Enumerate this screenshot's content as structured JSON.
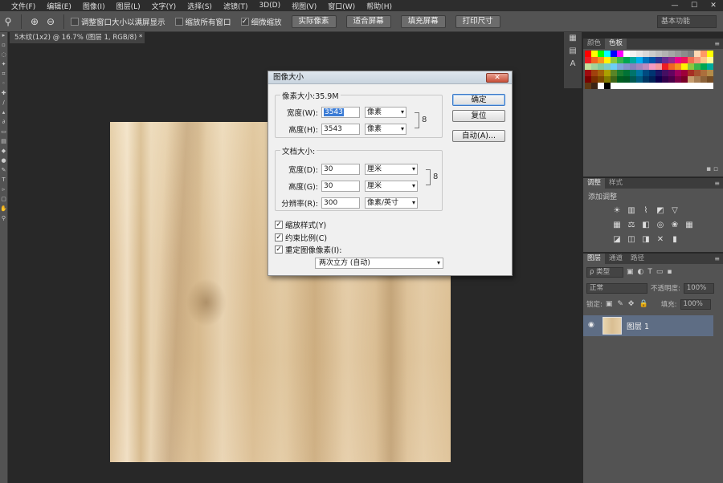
{
  "menubar": {
    "items": [
      "文件(F)",
      "编辑(E)",
      "图像(I)",
      "图层(L)",
      "文字(Y)",
      "选择(S)",
      "滤镜(T)",
      "3D(D)",
      "视图(V)",
      "窗口(W)",
      "帮助(H)"
    ],
    "window_controls": [
      "—",
      "☐",
      "✕"
    ]
  },
  "optbar": {
    "zoom_in_glyph": "⊕",
    "zoom_out_glyph": "⊖",
    "resize_windows_label": "调整窗口大小以满屏显示",
    "zoom_all_label": "缩放所有窗口",
    "scrubby_zoom_label": "细微缩放",
    "actual_pixels": "实际像素",
    "fit_screen": "适合屏幕",
    "fill_screen": "填充屏幕",
    "print_size": "打印尺寸",
    "workspace": "基本功能"
  },
  "doc_tab": {
    "title": "5木纹(1x2) @ 16.7% (图层 1, RGB/8) * ×"
  },
  "dialog": {
    "title": "图像大小",
    "close_glyph": "✕",
    "pixel_dimensions": "像素大小:35.9M",
    "width_label": "宽度(W):",
    "width_value": "3543",
    "width_unit": "像素",
    "height_label": "高度(H):",
    "height_value": "3543",
    "height_unit": "像素",
    "doc_size_legend": "文档大小:",
    "doc_width_label": "宽度(D):",
    "doc_width_value": "30",
    "doc_width_unit": "厘米",
    "doc_height_label": "高度(G):",
    "doc_height_value": "30",
    "doc_height_unit": "厘米",
    "resolution_label": "分辨率(R):",
    "resolution_value": "300",
    "resolution_unit": "像素/英寸",
    "scale_styles": "缩放样式(Y)",
    "constrain": "约束比例(C)",
    "resample": "重定图像像素(I):",
    "resample_method": "两次立方 (自动)",
    "ok": "确定",
    "reset": "复位",
    "auto": "自动(A)...",
    "check_glyph": "✓",
    "link_glyph": "8"
  },
  "panels": {
    "color_tabs": [
      "颜色",
      "色板"
    ],
    "adjust_tabs": [
      "调整",
      "样式"
    ],
    "adjust_add": "添加调整",
    "layers_tabs": [
      "图层",
      "通道",
      "路径"
    ],
    "kind_filter": "ρ 类型",
    "blend_mode": "正常",
    "opacity_label": "不透明度:",
    "opacity_value": "100%",
    "lock_label": "锁定:",
    "fill_label": "填充:",
    "fill_value": "100%",
    "layer_name": "图层 1",
    "menu_glyph": "≡"
  },
  "swatch_colors": [
    "#ff0000",
    "#ffff00",
    "#00ff00",
    "#00ffff",
    "#0000ff",
    "#ff00ff",
    "#ffffff",
    "#f2f2f2",
    "#e6e6e6",
    "#d9d9d9",
    "#cccccc",
    "#bfbfbf",
    "#b3b3b3",
    "#a6a6a6",
    "#999999",
    "#8c8c8c",
    "#808080",
    "#ffd9b3",
    "#ff9966",
    "#ffff00",
    "#ed1c24",
    "#f26522",
    "#f7941d",
    "#fff200",
    "#8dc63f",
    "#39b54a",
    "#00a651",
    "#00a99d",
    "#00aeef",
    "#0072bc",
    "#0054a6",
    "#2e3192",
    "#662d91",
    "#92278f",
    "#ec008c",
    "#ed145b",
    "#f26c4f",
    "#f69679",
    "#fdc689",
    "#fff799",
    "#c4df9b",
    "#a3d39c",
    "#82ca9c",
    "#7accc8",
    "#6dcff6",
    "#7da7d9",
    "#8393ca",
    "#8781bd",
    "#a186be",
    "#bd8cbf",
    "#f49ac1",
    "#f5989d",
    "#ee1d23",
    "#f26522",
    "#f7941d",
    "#fff200",
    "#8dc63f",
    "#39b54a",
    "#00a651",
    "#00a99d",
    "#9e0b0f",
    "#a0410d",
    "#a36209",
    "#aba000",
    "#598527",
    "#1a7b30",
    "#007236",
    "#00746b",
    "#0076a3",
    "#004a80",
    "#003471",
    "#1b1464",
    "#440e62",
    "#630460",
    "#9e005d",
    "#9e0039",
    "#a62e23",
    "#a5522f",
    "#ab6f3c",
    "#b38c49",
    "#790000",
    "#7b2e00",
    "#7d4900",
    "#827b00",
    "#406618",
    "#005e20",
    "#005826",
    "#005952",
    "#005b7f",
    "#003663",
    "#002157",
    "#0d004c",
    "#32004b",
    "#4b0049",
    "#7b0046",
    "#7a0026",
    "#c69c6d",
    "#a67c52",
    "#8c6239",
    "#754c24",
    "#603913",
    "#3c2415",
    "#ffffff",
    "#000000",
    "#ffffff",
    "#ffffff",
    "#ffffff",
    "#ffffff",
    "#ffffff",
    "#ffffff",
    "#ffffff",
    "#ffffff",
    "#ffffff",
    "#ffffff",
    "#ffffff",
    "#ffffff",
    "#ffffff",
    "#ffffff",
    "#ffffff",
    "#ffffff"
  ],
  "accent_colors": {
    "ui_bg": "#535353",
    "canvas_bg": "#282828",
    "dialog_bg": "#f0f0f0",
    "selection_blue": "#3a7bd5",
    "layer_selected": "#5e6d84"
  }
}
